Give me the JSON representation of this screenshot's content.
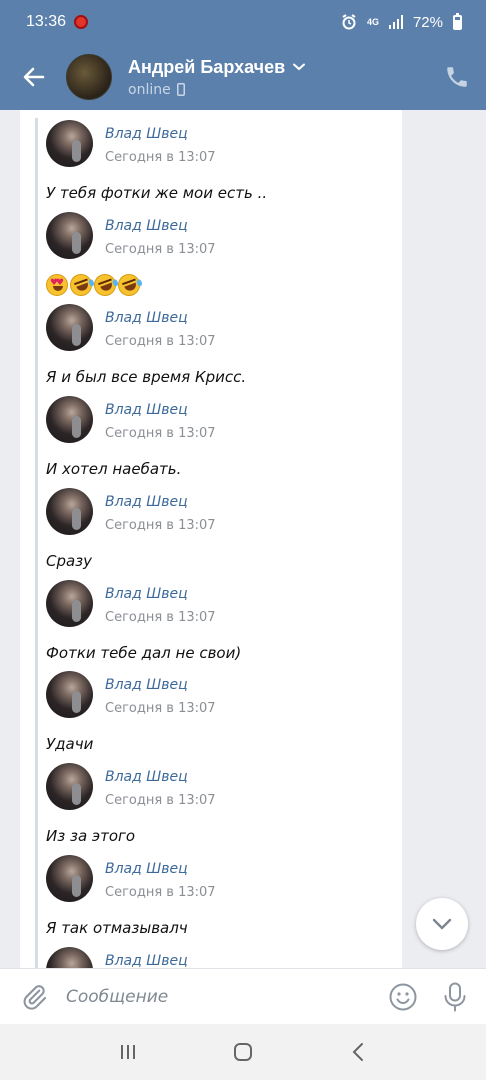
{
  "status_bar": {
    "time": "13:36",
    "network": "4G",
    "battery": "72%"
  },
  "header": {
    "contact_name": "Андрей Бархачев",
    "status": "online"
  },
  "messages": [
    {
      "author": "Влад Швец",
      "time": "Сегодня в 13:07",
      "text": "У тебя фотки же мои есть .."
    },
    {
      "author": "Влад Швец",
      "time": "Сегодня в 13:07",
      "text": "",
      "emoji": [
        "heart-eyes",
        "rofl",
        "rofl",
        "rofl"
      ]
    },
    {
      "author": "Влад Швец",
      "time": "Сегодня в 13:07",
      "text": "Я и был все время Крисс."
    },
    {
      "author": "Влад Швец",
      "time": "Сегодня в 13:07",
      "text": "И хотел наебать."
    },
    {
      "author": "Влад Швец",
      "time": "Сегодня в 13:07",
      "text": "Сразу"
    },
    {
      "author": "Влад Швец",
      "time": "Сегодня в 13:07",
      "text": "Фотки тебе дал не свои)"
    },
    {
      "author": "Влад Швец",
      "time": "Сегодня в 13:07",
      "text": "Удачи"
    },
    {
      "author": "Влад Швец",
      "time": "Сегодня в 13:07",
      "text": "Из за этого"
    },
    {
      "author": "Влад Швец",
      "time": "Сегодня в 13:07",
      "text": "Я так отмазывалч"
    },
    {
      "author": "Влад Швец",
      "time": "",
      "text": ""
    }
  ],
  "composer": {
    "placeholder": "Сообщение"
  },
  "colors": {
    "header_bg": "#5b80ab",
    "author": "#3e6a9a",
    "chat_bg": "#ecedf1"
  },
  "icons": {
    "back": "arrow-left-icon",
    "dropdown": "chevron-down-icon",
    "mobile": "mobile-phone-icon",
    "call": "phone-icon",
    "attach": "paperclip-icon",
    "emoji": "smile-icon",
    "mic": "microphone-icon",
    "scroll": "chevron-down-icon"
  }
}
